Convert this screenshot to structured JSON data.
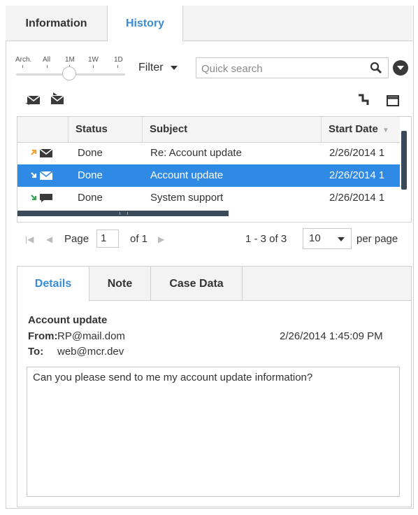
{
  "tabs": {
    "information": "Information",
    "history": "History"
  },
  "slider": {
    "labels": [
      "Arch.",
      "All",
      "1M",
      "1W",
      "1D"
    ],
    "selected": "1M"
  },
  "filter": {
    "label": "Filter"
  },
  "search": {
    "placeholder": "Quick search"
  },
  "toolbar_icons": [
    "email-icon",
    "email-alt-icon",
    "connector-icon",
    "window-icon"
  ],
  "grid": {
    "headers": {
      "status": "Status",
      "subject": "Subject",
      "start_date": "Start Date"
    },
    "rows": [
      {
        "direction": "outbound",
        "media": "email",
        "status": "Done",
        "subject": "Re: Account update",
        "start_date": "2/26/2014 1",
        "selected": false
      },
      {
        "direction": "inbound",
        "media": "email",
        "status": "Done",
        "subject": "Account update",
        "start_date": "2/26/2014 1",
        "selected": true
      },
      {
        "direction": "inbound",
        "media": "chat",
        "status": "Done",
        "subject": "System support",
        "start_date": "2/26/2014 1",
        "selected": false
      }
    ]
  },
  "pager": {
    "page_label": "Page",
    "page": "1",
    "of_label": "of 1",
    "range": "1 - 3 of 3",
    "per_page_value": "10",
    "per_page_label": "per page"
  },
  "details": {
    "tabs": {
      "details": "Details",
      "note": "Note",
      "case_data": "Case Data"
    },
    "subject": "Account update",
    "from_label": "From:",
    "from": "RP@mail.dom",
    "to_label": "To:",
    "to": "web@mcr.dev",
    "date": "2/26/2014 1:45:09 PM",
    "body": "Can you please send to me my account update information?"
  },
  "colors": {
    "accent": "#3a8cd6",
    "selection": "#2f8ae5",
    "outbound_arrow": "#f0a030",
    "inbound_arrow": "#3aa35a"
  }
}
